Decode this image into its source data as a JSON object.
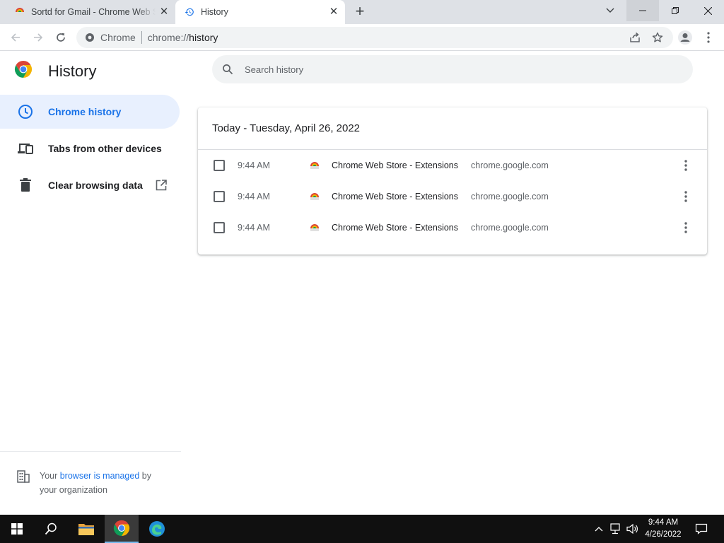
{
  "tabs": [
    {
      "title": "Sortd for Gmail - Chrome Web Store",
      "icon": "chrome-web-store-icon"
    },
    {
      "title": "History",
      "icon": "history-icon"
    }
  ],
  "omnibox": {
    "origin": "Chrome",
    "url_scheme": "chrome://",
    "url_host": "history"
  },
  "page": {
    "title": "History",
    "search_placeholder": "Search history"
  },
  "sidebar": {
    "items": [
      {
        "label": "Chrome history",
        "icon": "clock-icon"
      },
      {
        "label": "Tabs from other devices",
        "icon": "devices-icon"
      },
      {
        "label": "Clear browsing data",
        "icon": "trash-icon"
      }
    ],
    "managed": {
      "prefix": "Your ",
      "link": "browser is managed",
      "suffix": " by your organization"
    }
  },
  "history": {
    "date_header": "Today - Tuesday, April 26, 2022",
    "entries": [
      {
        "time": "9:44 AM",
        "title": "Chrome Web Store - Extensions",
        "domain": "chrome.google.com"
      },
      {
        "time": "9:44 AM",
        "title": "Chrome Web Store - Extensions",
        "domain": "chrome.google.com"
      },
      {
        "time": "9:44 AM",
        "title": "Chrome Web Store - Extensions",
        "domain": "chrome.google.com"
      }
    ]
  },
  "taskbar": {
    "time": "9:44 AM",
    "date": "4/26/2022"
  },
  "colors": {
    "accent": "#1a73e8",
    "selected_bg": "#e8f0fe",
    "titlebar": "#dee1e6",
    "taskbar": "#101010"
  }
}
